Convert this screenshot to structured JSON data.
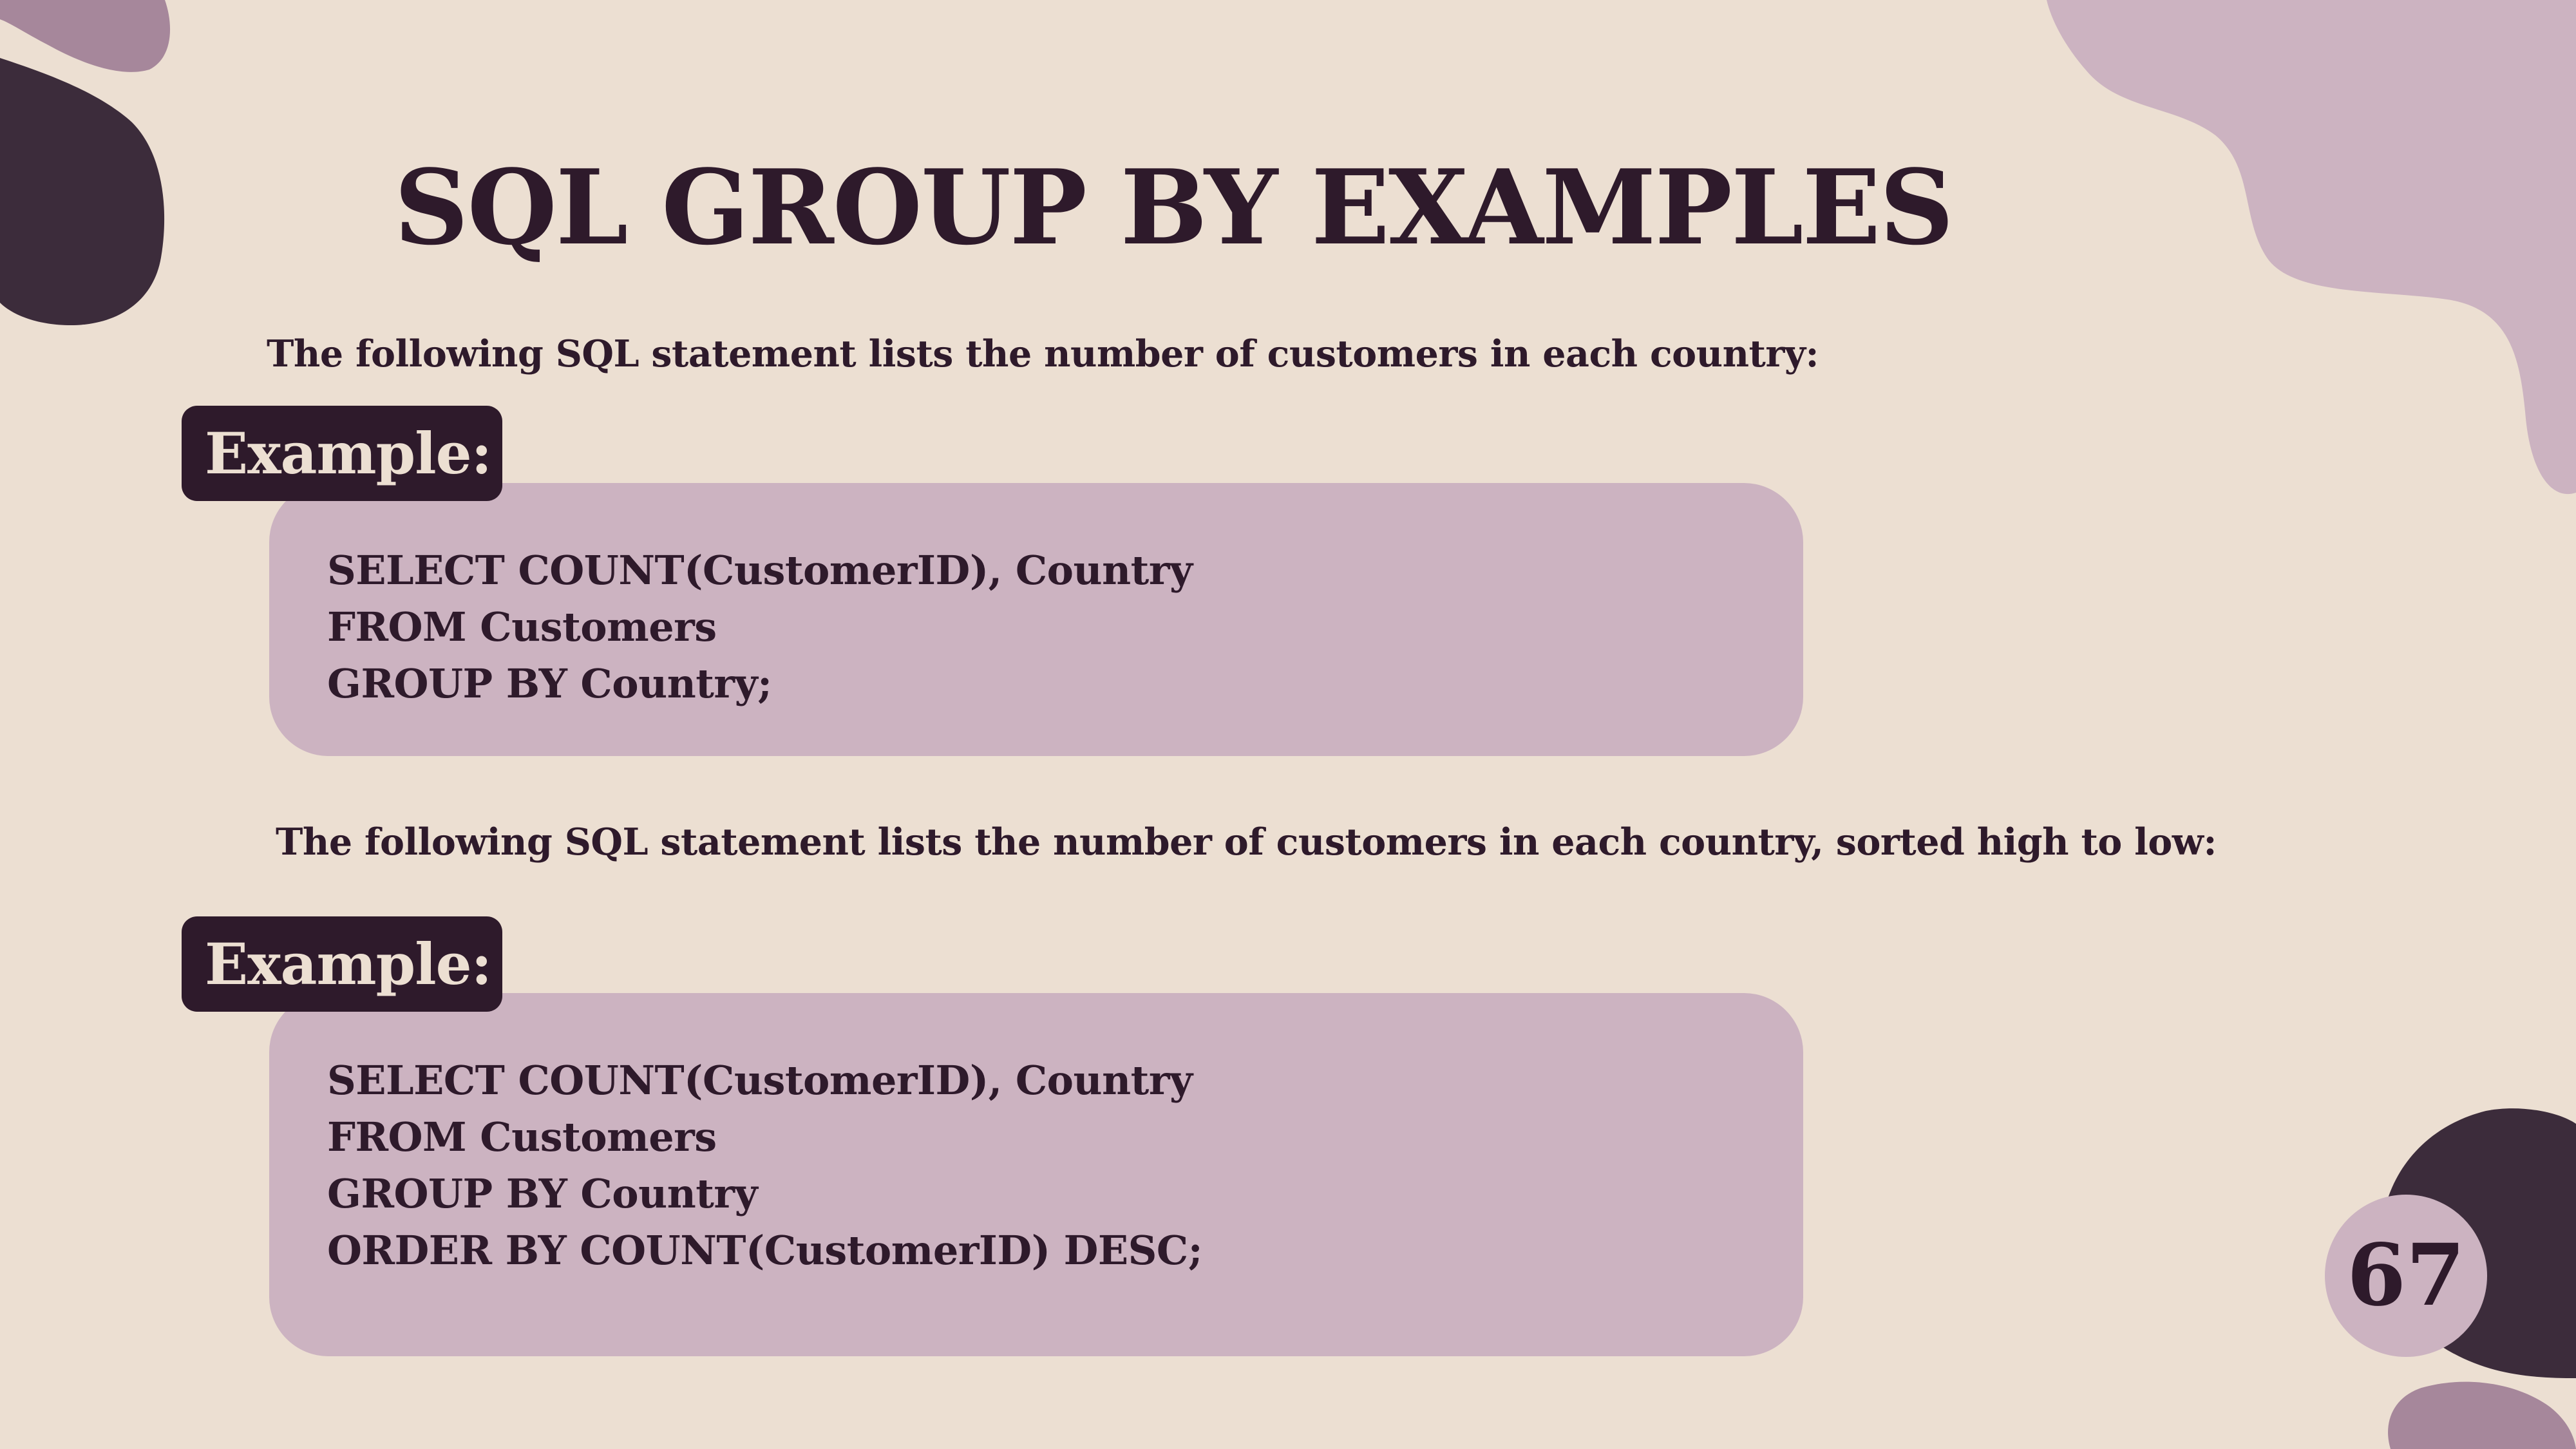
{
  "slide": {
    "title": "SQL GROUP BY EXAMPLES",
    "page_number": "67",
    "colors": {
      "background": "#ecdfd2",
      "dark": "#2e1a2b",
      "code_box": "#ccb3c1",
      "blob_mauve": "#a6879b",
      "blob_dark": "#3c2c3b"
    }
  },
  "example_1": {
    "description": "The following SQL statement lists the number of customers in each country:",
    "tag": "Example:",
    "code": [
      "SELECT COUNT(CustomerID), Country",
      "FROM Customers",
      "GROUP BY Country;"
    ]
  },
  "example_2": {
    "description": "The following SQL statement lists the number of customers in each country, sorted high to low:",
    "tag": "Example:",
    "code": [
      "SELECT COUNT(CustomerID), Country",
      "FROM Customers",
      "GROUP BY Country",
      "ORDER BY COUNT(CustomerID) DESC;"
    ]
  }
}
